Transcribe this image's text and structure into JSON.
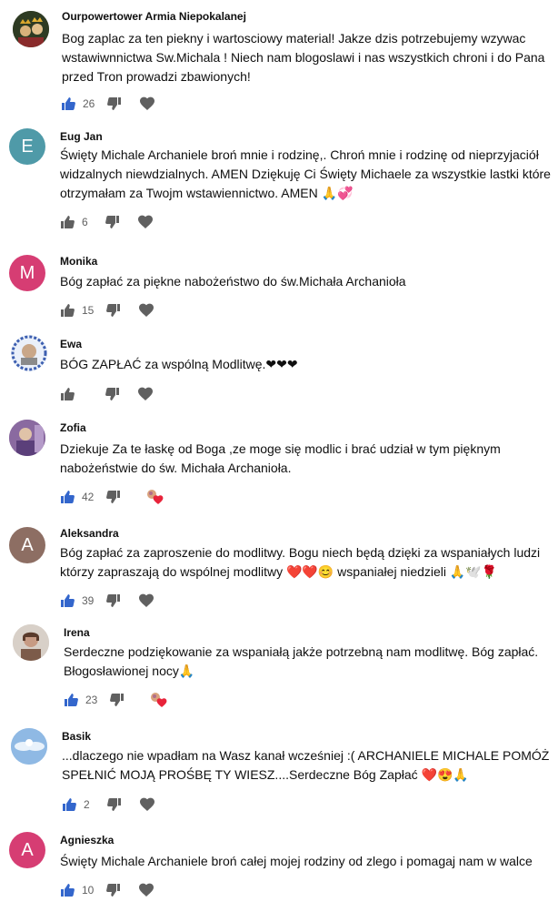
{
  "comments": [
    {
      "author": "Ourpowertower Armia Niepokalanej",
      "text": "Bog zaplac za ten piekny i wartosciowy material! Jakze dzis potrzebujemy wzywac wstawiwnnictwa Sw.Michala ! Niech nam blogoslawi i nas wszystkich chroni i do Pana przed Tron prowadzi zbawionych!",
      "likes": "26",
      "liked": true,
      "avatar": {
        "type": "image",
        "icon": "crowned-figures-avatar"
      }
    },
    {
      "author": "Eug Jan",
      "text": "Święty Michale Archaniele broń mnie i rodzinę,. Chroń mnie i rodzinę od nieprzyjaciół widzalnych niewdzialnych. AMEN Dziękuję Ci Święty Michaele za wszystkie lastki które otrzymałam za Twojm wstawiennictwo. AMEN 🙏💞",
      "likes": "6",
      "liked": false,
      "avatar": {
        "type": "letter",
        "letter": "E",
        "color": "#4f9aa8"
      }
    },
    {
      "author": "Monika",
      "text": "Bóg zapłać za piękne nabożeństwo do św.Michała Archanioła",
      "likes": "15",
      "liked": false,
      "avatar": {
        "type": "letter",
        "letter": "M",
        "color": "#d63d73"
      }
    },
    {
      "author": "Ewa",
      "text": "BÓG ZAPŁAĆ za wspólną Modlitwę.❤❤❤",
      "likes": "",
      "liked": false,
      "avatar": {
        "type": "image",
        "icon": "lace-portrait-avatar"
      }
    },
    {
      "author": "Zofia",
      "text": "Dziekuje Za te łaskę od Boga ,ze moge  się modlic  i brać udział w tym pięknym nabożeństwie do św. Michała Archanioła.",
      "likes": "42",
      "liked": true,
      "heart": "pinned",
      "avatar": {
        "type": "image",
        "icon": "purple-photo-avatar"
      }
    },
    {
      "author": "Aleksandra",
      "text": "Bóg zapłać za zaproszenie do modlitwy. Bogu niech będą dzięki za wspaniałych ludzi którzy zapraszają do wspólnej modlitwy ❤️❤️😊 wspaniałej niedzieli 🙏🕊️🌹",
      "likes": "39",
      "liked": true,
      "avatar": {
        "type": "letter",
        "letter": "A",
        "color": "#8d6e63"
      }
    },
    {
      "author": "Irena",
      "text": "Serdeczne podziękowanie za wspaniałą jakże potrzebną nam modlitwę. Bóg zapłać. Błogosławionej nocy🙏",
      "likes": "23",
      "liked": true,
      "heart": "pinned",
      "avatar": {
        "type": "image",
        "icon": "woman-photo-avatar"
      }
    },
    {
      "author": "Basik",
      "text": "...dlaczego nie wpadłam na Wasz kanał wcześniej :( ARCHANIELE MICHALE POMÓŻ SPEŁNIĆ MOJĄ PROŚBĘ TY WIESZ....Serdeczne Bóg Zapłać ❤️😍🙏",
      "likes": "2",
      "liked": true,
      "avatar": {
        "type": "image",
        "icon": "angel-sky-avatar"
      }
    },
    {
      "author": "Agnieszka",
      "text": "Święty Michale Archaniele broń całej mojej rodziny od zlego i pomagaj nam w walce",
      "likes": "10",
      "liked": true,
      "avatar": {
        "type": "letter",
        "letter": "A",
        "color": "#d63d73"
      }
    }
  ],
  "colors": {
    "liked": "#3366cc",
    "icon": "#606060"
  }
}
